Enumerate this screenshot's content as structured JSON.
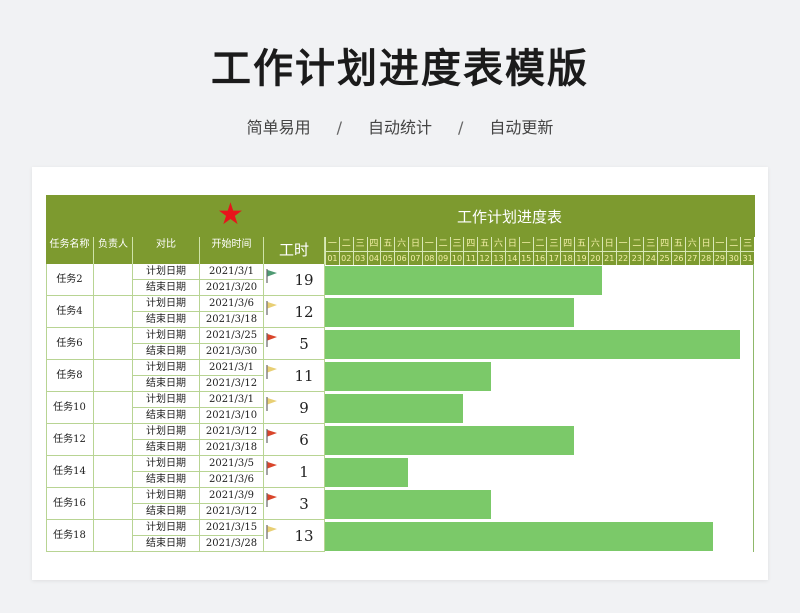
{
  "page": {
    "title": "工作计划进度表模版",
    "subtitle": [
      "简单易用",
      "自动统计",
      "自动更新"
    ],
    "separator": "/"
  },
  "sheet": {
    "star": "★",
    "header_title": "工作计划进度表",
    "columns": {
      "task": "任务名称",
      "owner": "负责人",
      "compare": "对比",
      "start": "开始时间",
      "hours": "工时"
    },
    "weekdays": [
      "一",
      "二",
      "三",
      "四",
      "五",
      "六",
      "日",
      "一",
      "二",
      "三",
      "四",
      "五",
      "六",
      "日",
      "一",
      "二",
      "三",
      "四",
      "五",
      "六",
      "日",
      "一",
      "二",
      "三",
      "四",
      "五",
      "六",
      "日",
      "一",
      "二",
      "三"
    ],
    "days": [
      "01",
      "02",
      "03",
      "04",
      "05",
      "06",
      "07",
      "08",
      "09",
      "10",
      "11",
      "12",
      "13",
      "14",
      "15",
      "16",
      "17",
      "18",
      "19",
      "20",
      "21",
      "22",
      "23",
      "24",
      "25",
      "26",
      "27",
      "28",
      "29",
      "30",
      "31"
    ],
    "plan_label": "计划日期",
    "end_label": "结束日期",
    "colors": {
      "header": "#7d9a2f",
      "bar": "#7bc969",
      "star": "#e8141b",
      "flag_green": "#4f9a73",
      "flag_red": "#d9452b",
      "flag_yellow": "#e8cf74"
    },
    "tasks": [
      {
        "name": "任务2",
        "plan": "2021/3/1",
        "end": "2021/3/20",
        "hours": "19",
        "flag": "green",
        "bar_start": 1,
        "bar_days": 20
      },
      {
        "name": "任务4",
        "plan": "2021/3/6",
        "end": "2021/3/18",
        "hours": "12",
        "flag": "yellow",
        "bar_start": 1,
        "bar_days": 18
      },
      {
        "name": "任务6",
        "plan": "2021/3/25",
        "end": "2021/3/30",
        "hours": "5",
        "flag": "red",
        "bar_start": 1,
        "bar_days": 30
      },
      {
        "name": "任务8",
        "plan": "2021/3/1",
        "end": "2021/3/12",
        "hours": "11",
        "flag": "yellow",
        "bar_start": 1,
        "bar_days": 12
      },
      {
        "name": "任务10",
        "plan": "2021/3/1",
        "end": "2021/3/10",
        "hours": "9",
        "flag": "yellow",
        "bar_start": 1,
        "bar_days": 10
      },
      {
        "name": "任务12",
        "plan": "2021/3/12",
        "end": "2021/3/18",
        "hours": "6",
        "flag": "red",
        "bar_start": 1,
        "bar_days": 18
      },
      {
        "name": "任务14",
        "plan": "2021/3/5",
        "end": "2021/3/6",
        "hours": "1",
        "flag": "red",
        "bar_start": 1,
        "bar_days": 6
      },
      {
        "name": "任务16",
        "plan": "2021/3/9",
        "end": "2021/3/12",
        "hours": "3",
        "flag": "red",
        "bar_start": 1,
        "bar_days": 12
      },
      {
        "name": "任务18",
        "plan": "2021/3/15",
        "end": "2021/3/28",
        "hours": "13",
        "flag": "yellow",
        "bar_start": 1,
        "bar_days": 28
      }
    ]
  }
}
